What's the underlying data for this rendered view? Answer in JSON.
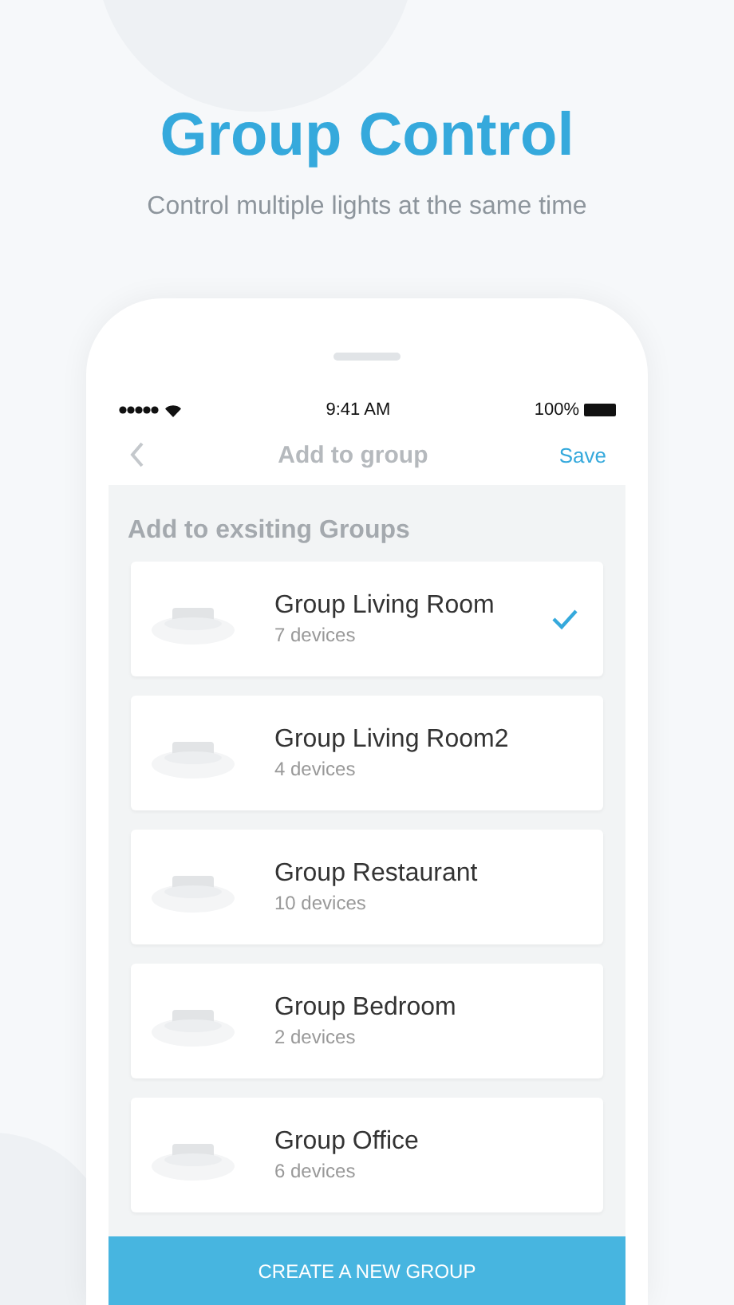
{
  "header": {
    "title": "Group Control",
    "subtitle": "Control multiple lights at the same time"
  },
  "status_bar": {
    "time": "9:41 AM",
    "battery": "100%"
  },
  "nav": {
    "title": "Add to group",
    "action": "Save"
  },
  "section_title": "Add to exsiting Groups",
  "groups": [
    {
      "name": "Group Living Room",
      "count": "7 devices",
      "selected": true
    },
    {
      "name": "Group Living Room2",
      "count": "4 devices",
      "selected": false
    },
    {
      "name": "Group Restaurant",
      "count": "10 devices",
      "selected": false
    },
    {
      "name": "Group Bedroom",
      "count": "2 devices",
      "selected": false
    },
    {
      "name": "Group Office",
      "count": "6 devices",
      "selected": false
    }
  ],
  "button": "CREATE A NEW GROUP"
}
